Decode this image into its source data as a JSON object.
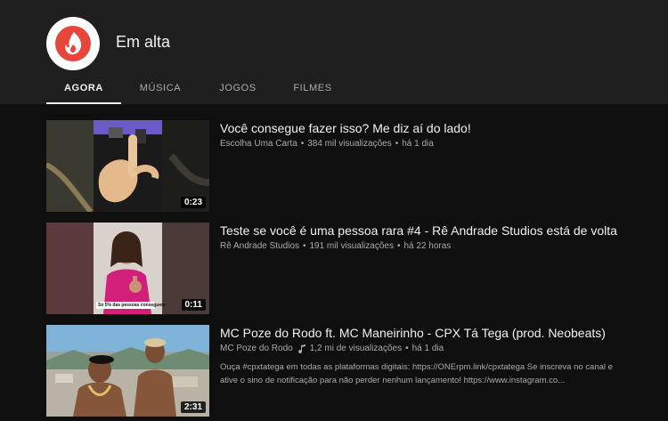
{
  "header": {
    "title": "Em alta",
    "tabs": [
      {
        "label": "AGORA",
        "active": true
      },
      {
        "label": "MÚSICA",
        "active": false
      },
      {
        "label": "JOGOS",
        "active": false
      },
      {
        "label": "FILMES",
        "active": false
      }
    ]
  },
  "colors": {
    "background": "#0f0f0f",
    "header_background": "#1f1f1f",
    "logo_red": "#e9463b",
    "text_primary": "#f1f1f1",
    "text_secondary": "#aaaaaa"
  },
  "videos": [
    {
      "title": "Você consegue fazer isso? Me diz aí do lado!",
      "channel": "Escolha Uma Carta",
      "views": "384 mil visualizações",
      "age": "há 1 dia",
      "duration": "0:23"
    },
    {
      "title": "Teste se você é uma pessoa rara #4 - Rê Andrade Studios está de volta",
      "channel": "Rê Andrade Studios",
      "views": "191 mil visualizações",
      "age": "há 22 horas",
      "duration": "0:11",
      "thumb_caption": "Só 5% das pessoas conseguem"
    },
    {
      "title": "MC Poze do Rodo ft. MC Maneirinho - CPX Tá Tega (prod. Neobeats)",
      "channel": "MC Poze do Rodo",
      "views": "1,2 mi de visualizações",
      "age": "há 1 dia",
      "duration": "2:31",
      "description": "Ouça #cpxtatega em todas as plataformas digitais: https://ONErpm.link/cpxtatega Se inscreva no canal e ative o sino de notificação para não perder nenhum lançamento! https://www.instagram.co..."
    }
  ]
}
